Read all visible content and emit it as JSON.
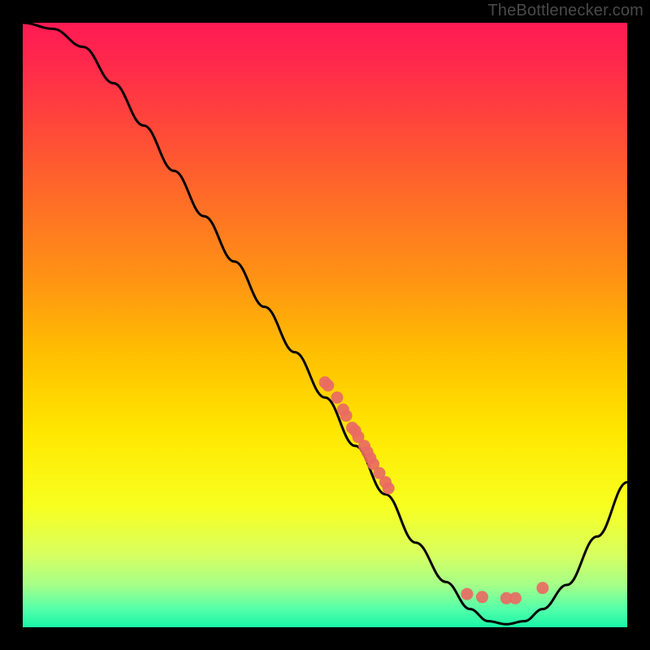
{
  "watermark": "TheBottlenecker.com",
  "chart_data": {
    "type": "line",
    "title": "",
    "xlabel": "",
    "ylabel": "",
    "xlim": [
      0,
      100
    ],
    "ylim": [
      0,
      100
    ],
    "curve": [
      {
        "x": 0,
        "y": 100
      },
      {
        "x": 5,
        "y": 99
      },
      {
        "x": 10,
        "y": 96
      },
      {
        "x": 15,
        "y": 90
      },
      {
        "x": 20,
        "y": 83
      },
      {
        "x": 25,
        "y": 75.5
      },
      {
        "x": 30,
        "y": 68
      },
      {
        "x": 35,
        "y": 60.5
      },
      {
        "x": 40,
        "y": 53
      },
      {
        "x": 45,
        "y": 45.5
      },
      {
        "x": 50,
        "y": 38
      },
      {
        "x": 55,
        "y": 30
      },
      {
        "x": 60,
        "y": 22
      },
      {
        "x": 65,
        "y": 14
      },
      {
        "x": 70,
        "y": 7.5
      },
      {
        "x": 74,
        "y": 3
      },
      {
        "x": 77,
        "y": 1
      },
      {
        "x": 80,
        "y": 0.5
      },
      {
        "x": 83,
        "y": 1
      },
      {
        "x": 86,
        "y": 3
      },
      {
        "x": 90,
        "y": 7
      },
      {
        "x": 95,
        "y": 15
      },
      {
        "x": 100,
        "y": 24
      }
    ],
    "scatter": [
      {
        "x": 50.0,
        "y": 40.5
      },
      {
        "x": 50.5,
        "y": 40.0
      },
      {
        "x": 52.0,
        "y": 38.0
      },
      {
        "x": 53.0,
        "y": 36.0
      },
      {
        "x": 53.5,
        "y": 35.0
      },
      {
        "x": 54.5,
        "y": 33.0
      },
      {
        "x": 55.0,
        "y": 32.5
      },
      {
        "x": 55.5,
        "y": 31.5
      },
      {
        "x": 56.5,
        "y": 30.0
      },
      {
        "x": 57.0,
        "y": 29.0
      },
      {
        "x": 57.5,
        "y": 28.0
      },
      {
        "x": 58.0,
        "y": 27.0
      },
      {
        "x": 59.0,
        "y": 25.5
      },
      {
        "x": 60.0,
        "y": 24.0
      },
      {
        "x": 60.5,
        "y": 23.0
      },
      {
        "x": 73.5,
        "y": 5.5
      },
      {
        "x": 76.0,
        "y": 5.0
      },
      {
        "x": 80.0,
        "y": 4.8
      },
      {
        "x": 81.5,
        "y": 4.8
      },
      {
        "x": 86.0,
        "y": 6.5
      }
    ],
    "gradient_stops": [
      {
        "offset": 0.0,
        "color": "#ff1a54"
      },
      {
        "offset": 0.07,
        "color": "#ff2a4b"
      },
      {
        "offset": 0.18,
        "color": "#ff4a38"
      },
      {
        "offset": 0.3,
        "color": "#ff6f26"
      },
      {
        "offset": 0.42,
        "color": "#ff9214"
      },
      {
        "offset": 0.55,
        "color": "#ffc000"
      },
      {
        "offset": 0.68,
        "color": "#ffe800"
      },
      {
        "offset": 0.8,
        "color": "#f8ff20"
      },
      {
        "offset": 0.88,
        "color": "#d8ff60"
      },
      {
        "offset": 0.93,
        "color": "#a5ff88"
      },
      {
        "offset": 0.97,
        "color": "#54ffaa"
      },
      {
        "offset": 1.0,
        "color": "#18f5a7"
      }
    ],
    "marker_color": "#e86a63",
    "line_color": "#000000"
  }
}
